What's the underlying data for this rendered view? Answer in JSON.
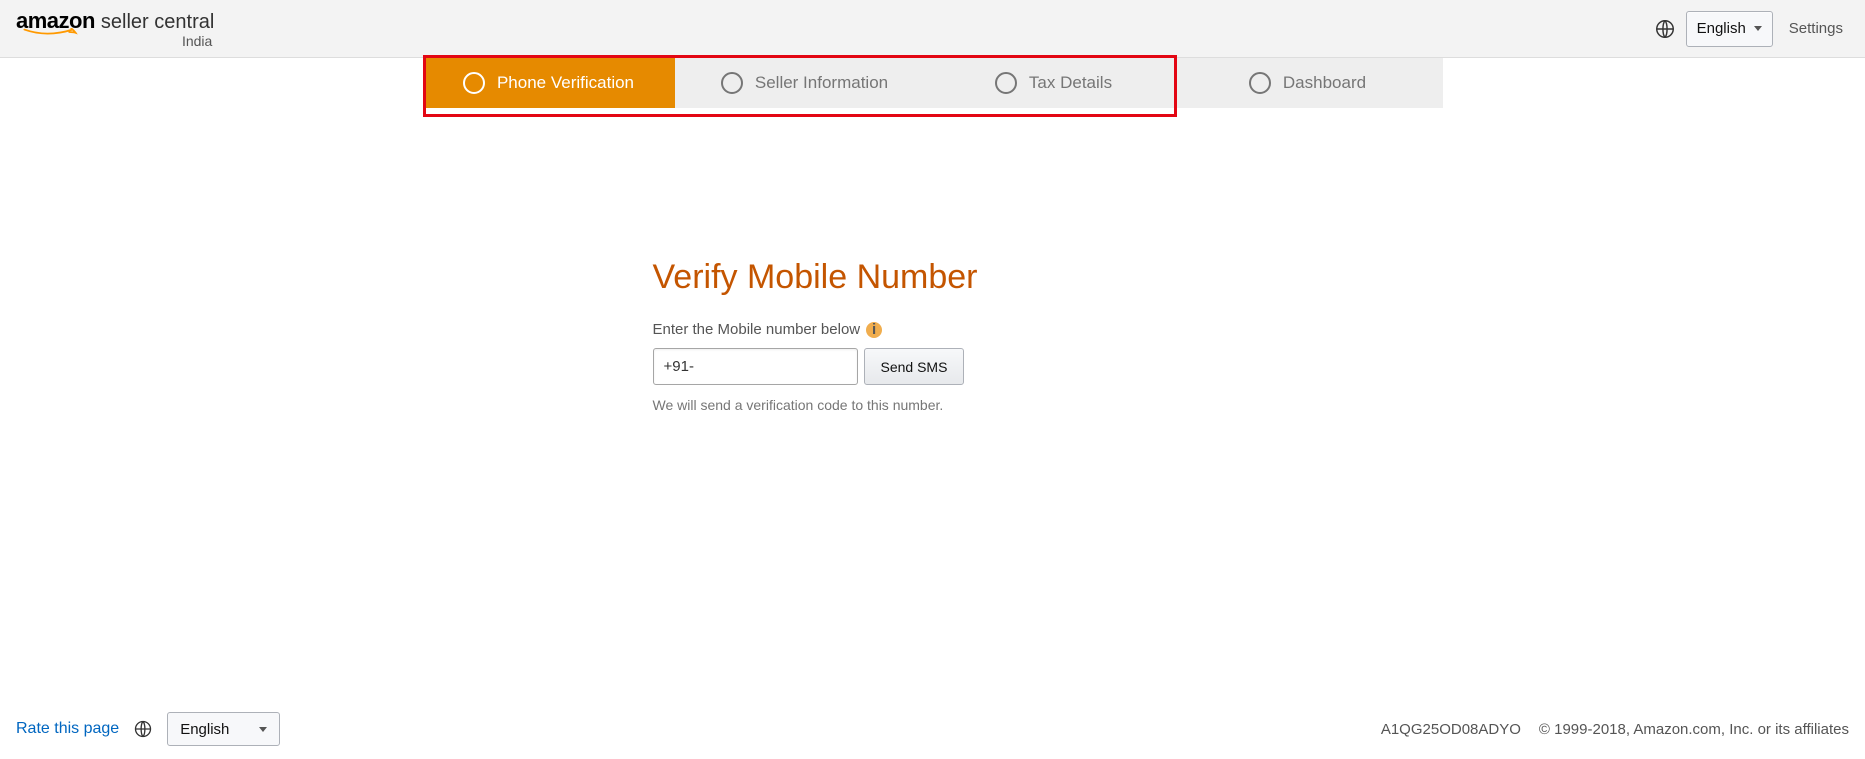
{
  "header": {
    "logo_amazon": "amazon",
    "logo_sc": "seller central",
    "logo_region": "India",
    "language": "English",
    "settings": "Settings"
  },
  "steps": [
    {
      "label": "Phone Verification",
      "active": true
    },
    {
      "label": "Seller Information",
      "active": false
    },
    {
      "label": "Tax Details",
      "active": false
    },
    {
      "label": "Dashboard",
      "active": false
    }
  ],
  "form": {
    "heading": "Verify Mobile Number",
    "label": "Enter the Mobile number below",
    "info_glyph": "i",
    "phone_value": "+91-",
    "send_button": "Send SMS",
    "help_text": "We will send a verification code to this number."
  },
  "footer": {
    "rate": "Rate this page",
    "language": "English",
    "id": "A1QG25OD08ADYO",
    "copyright": "© 1999-2018, Amazon.com, Inc. or its affiliates"
  }
}
